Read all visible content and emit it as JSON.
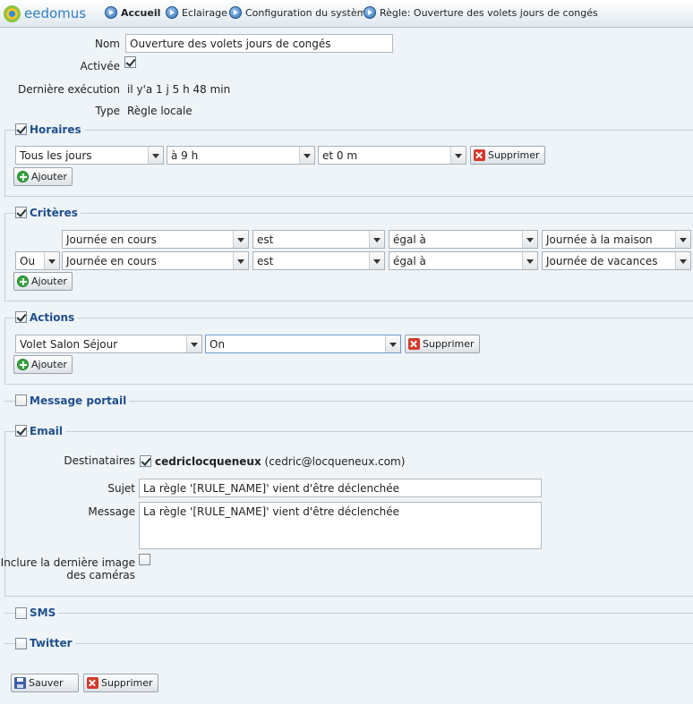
{
  "app": {
    "logo_text": "eedomus"
  },
  "breadcrumb": [
    {
      "label": "Accueil",
      "icon": "arrow-right-circle-icon"
    },
    {
      "label": "Eclairage",
      "icon": "arrow-right-circle-icon"
    },
    {
      "label": "Configuration du système",
      "icon": "arrow-right-circle-icon"
    },
    {
      "label": "Règle: Ouverture des volets jours de congés",
      "icon": "arrow-right-circle-icon"
    }
  ],
  "general": {
    "nom_label": "Nom",
    "nom_value": "Ouverture des volets jours de congés",
    "activee_label": "Activée",
    "activee_checked": true,
    "derniere_label": "Dernière exécution",
    "derniere_value": "il y'a 1 j 5 h 48 min",
    "type_label": "Type",
    "type_value": "Règle locale"
  },
  "horaires": {
    "title": "Horaires",
    "checked": true,
    "day": "Tous les jours",
    "hour": "à 9 h",
    "minute": "et 0 m",
    "delete_label": "Supprimer",
    "add_label": "Ajouter"
  },
  "criteres": {
    "title": "Critères",
    "checked": true,
    "rows": [
      {
        "logic": "",
        "subject": "Journée en cours",
        "verb": "est",
        "operator": "égal à",
        "value": "Journée à la maison"
      },
      {
        "logic": "Ou",
        "subject": "Journée en cours",
        "verb": "est",
        "operator": "égal à",
        "value": "Journée de vacances"
      }
    ],
    "add_label": "Ajouter"
  },
  "actions": {
    "title": "Actions",
    "checked": true,
    "device": "Volet Salon Séjour",
    "state": "On",
    "delete_label": "Supprimer",
    "add_label": "Ajouter"
  },
  "message_portail": {
    "title": "Message portail",
    "checked": false
  },
  "email": {
    "title": "Email",
    "checked": true,
    "destinataires_label": "Destinataires",
    "recipient_checked": true,
    "recipient_name": "cedriclocqueneux",
    "recipient_email": "(cedric@locqueneux.com)",
    "sujet_label": "Sujet",
    "sujet_value": "La règle '[RULE_NAME]' vient d'être déclenchée",
    "message_label": "Message",
    "message_value": "La règle '[RULE_NAME]' vient d'être déclenchée",
    "inclure_label_1": "Inclure la dernière image",
    "inclure_label_2": "des caméras",
    "inclure_checked": false
  },
  "sms": {
    "title": "SMS",
    "checked": false
  },
  "twitter": {
    "title": "Twitter",
    "checked": false
  },
  "footer": {
    "save_label": "Sauver",
    "delete_label": "Supprimer"
  }
}
